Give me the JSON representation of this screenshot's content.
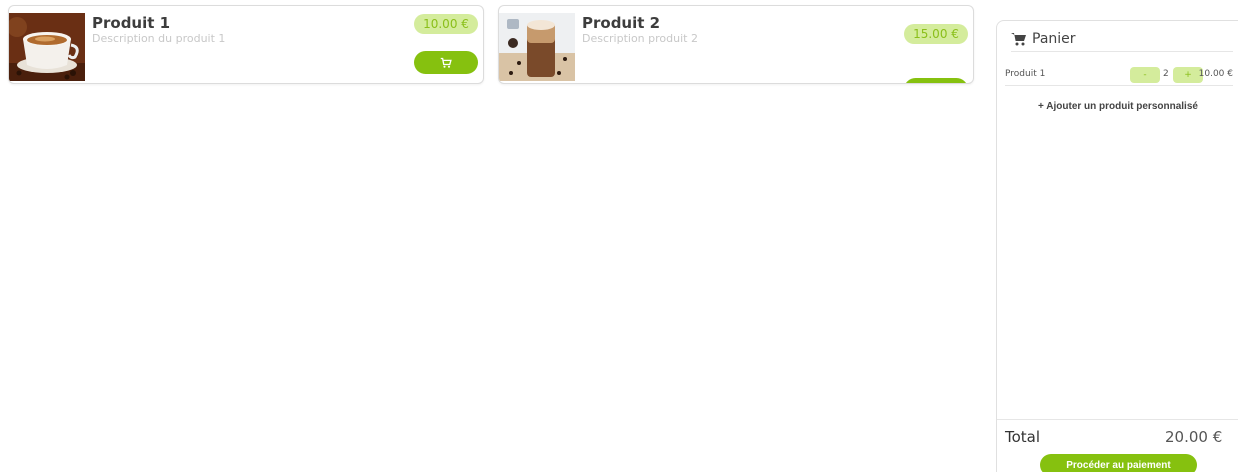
{
  "products": [
    {
      "title": "Produit 1",
      "description": "Description du produit 1",
      "price": "10.00 €",
      "image_icon": "coffee-cup-photo"
    },
    {
      "title": "Produit 2",
      "description": "Description produit 2",
      "price": "15.00 €",
      "image_icon": "iced-coffee-photo"
    }
  ],
  "cart": {
    "title": "Panier",
    "icon": "shopping-cart-icon",
    "items": [
      {
        "name": "Produit 1",
        "minus": "-",
        "qty": "2",
        "plus": "+",
        "price": "10.00 €"
      }
    ],
    "add_custom_label": "+ Ajouter un produit personnalisé",
    "total_label": "Total",
    "total_value": "20.00 €",
    "checkout_label": "Procéder au paiement"
  },
  "colors": {
    "accent": "#86c10f",
    "accent_light": "#d4ec9c",
    "price_text": "#8abf1a"
  }
}
